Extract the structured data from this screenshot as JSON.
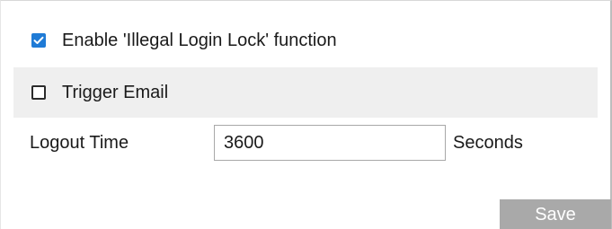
{
  "settings": {
    "enable_lock": {
      "label": "Enable 'Illegal Login Lock' function",
      "checked": true
    },
    "trigger_email": {
      "label": "Trigger Email",
      "checked": false
    },
    "logout_time": {
      "label": "Logout Time",
      "value": "3600",
      "unit": "Seconds"
    }
  },
  "actions": {
    "save_label": "Save"
  },
  "colors": {
    "checkbox_checked": "#1f7bd6",
    "email_row_background": "#efefef",
    "save_button_background": "#a9a9a9"
  },
  "icons": {
    "checked": "checkmark-icon"
  }
}
